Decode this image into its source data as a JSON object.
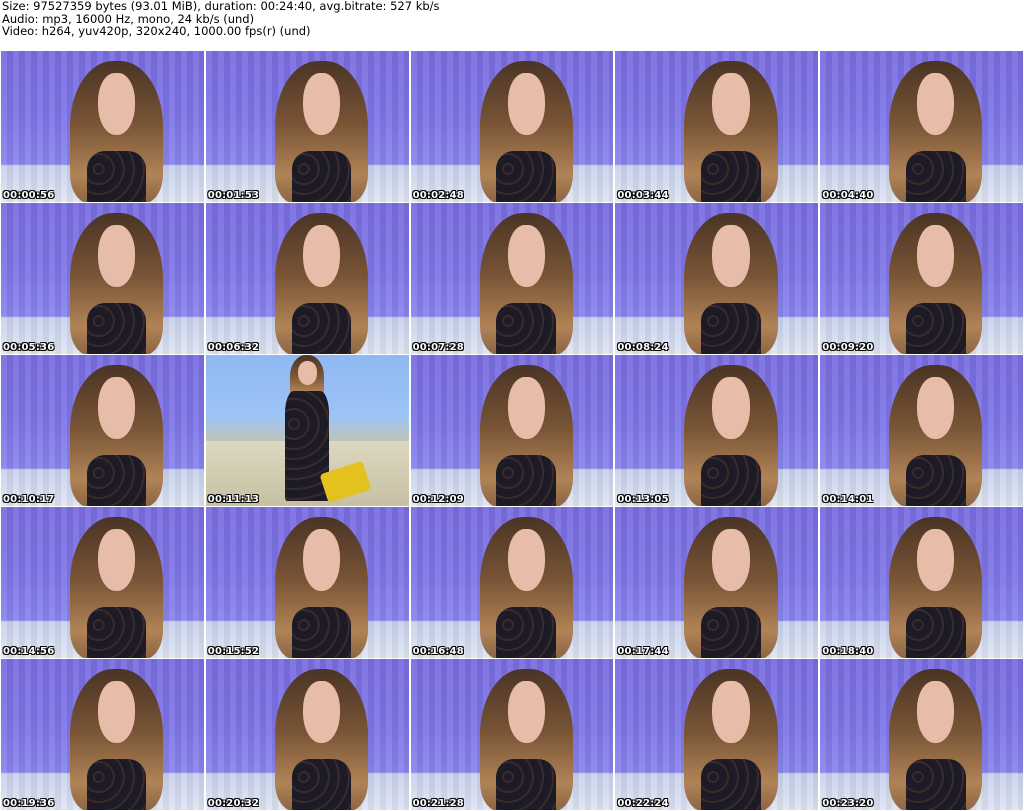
{
  "header": {
    "size_line": "Size: 97527359 bytes (93.01 MiB), duration: 00:24:40, avg.bitrate: 527 kb/s",
    "audio_line": "Audio: mp3, 16000 Hz, mono, 24 kb/s (und)",
    "video_line": "Video: h264, yuv420p, 320x240, 1000.00 fps(r) (und)"
  },
  "thumbnails": [
    {
      "timestamp": "00:00:56"
    },
    {
      "timestamp": "00:01:53"
    },
    {
      "timestamp": "00:02:48"
    },
    {
      "timestamp": "00:03:44"
    },
    {
      "timestamp": "00:04:40"
    },
    {
      "timestamp": "00:05:36"
    },
    {
      "timestamp": "00:06:32"
    },
    {
      "timestamp": "00:07:28"
    },
    {
      "timestamp": "00:08:24"
    },
    {
      "timestamp": "00:09:20"
    },
    {
      "timestamp": "00:10:17"
    },
    {
      "timestamp": "00:11:13"
    },
    {
      "timestamp": "00:12:09"
    },
    {
      "timestamp": "00:13:05"
    },
    {
      "timestamp": "00:14:01"
    },
    {
      "timestamp": "00:14:56"
    },
    {
      "timestamp": "00:15:52"
    },
    {
      "timestamp": "00:16:48"
    },
    {
      "timestamp": "00:17:44"
    },
    {
      "timestamp": "00:18:40"
    },
    {
      "timestamp": "00:19:36"
    },
    {
      "timestamp": "00:20:32"
    },
    {
      "timestamp": "00:21:28"
    },
    {
      "timestamp": "00:22:24"
    },
    {
      "timestamp": "00:23:20"
    }
  ]
}
